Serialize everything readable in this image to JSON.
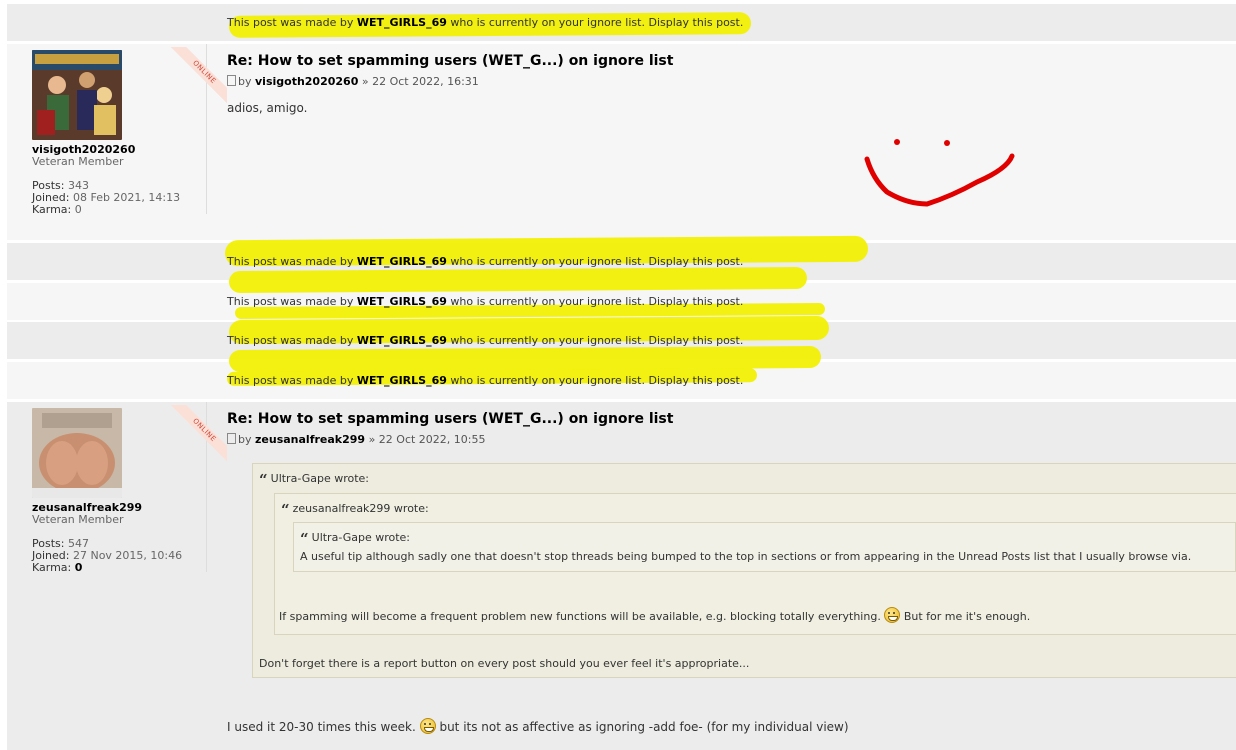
{
  "ignored_notice": {
    "prefix": "This post was made by",
    "user": "WET_GIRLS_69",
    "suffix": "who is currently on your ignore list.",
    "link": "Display this post."
  },
  "posts": [
    {
      "title": "Re: How to set spamming users (WET_G...) on ignore list",
      "by_label": "by",
      "author": "visigoth2020260",
      "date": "» 22 Oct 2022, 16:31",
      "body": "adios, amigo.",
      "profile": {
        "username": "visigoth2020260",
        "rank": "Veteran Member",
        "status": "ONLINE",
        "posts_label": "Posts:",
        "posts": "343",
        "joined_label": "Joined:",
        "joined": "08 Feb 2021, 14:13",
        "karma_label": "Karma:",
        "karma": "0"
      }
    },
    {
      "title": "Re: How to set spamming users (WET_G...) on ignore list",
      "by_label": "by",
      "author": "zeusanalfreak299",
      "date": "» 22 Oct 2022, 10:55",
      "profile": {
        "username": "zeusanalfreak299",
        "rank": "Veteran Member",
        "status": "ONLINE",
        "posts_label": "Posts:",
        "posts": "547",
        "joined_label": "Joined:",
        "joined": "27 Nov 2015, 10:46",
        "karma_label": "Karma:",
        "karma": "0"
      },
      "quote_outer": {
        "author": "Ultra-Gape wrote:",
        "text": "Don't forget there is a report button on every post should you ever feel it's appropriate..."
      },
      "quote_middle": {
        "author": "zeusanalfreak299 wrote:",
        "text_before": "If spamming will become a frequent problem new functions will be available, e.g. blocking totally everything.",
        "text_after": "But for me it's enough."
      },
      "quote_inner": {
        "author": "Ultra-Gape wrote:",
        "text": "A useful tip although sadly one that doesn't stop threads being bumped to the top in sections or from appearing in the Unread Posts list that I usually browse via."
      },
      "body_before": "I used it 20-30 times this week.",
      "body_after": "but its not as affective as ignoring -add foe- (for my individual view)"
    }
  ],
  "colors": {
    "highlight": "#f2f000",
    "scribble": "#e00000",
    "quote_bg": "#eeecde"
  }
}
